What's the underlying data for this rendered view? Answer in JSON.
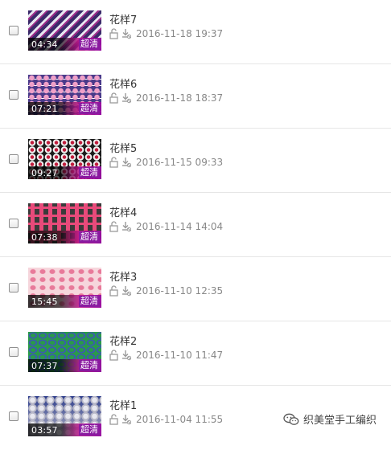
{
  "videos": [
    {
      "title": "花样7",
      "duration": "04:34",
      "quality": "超清",
      "date": "2016-11-18 19:37",
      "colors": [
        "#3a2a6a",
        "#e6e6f0",
        "#9c2c8a"
      ]
    },
    {
      "title": "花样6",
      "duration": "07:21",
      "quality": "超清",
      "date": "2016-11-18 18:37",
      "colors": [
        "#4a3a8a",
        "#f0a0c8",
        "#ffffff"
      ]
    },
    {
      "title": "花样5",
      "duration": "09:27",
      "quality": "超清",
      "date": "2016-11-15 09:33",
      "colors": [
        "#1a1a1a",
        "#f2f2f2",
        "#c01c3c"
      ]
    },
    {
      "title": "花样4",
      "duration": "07:38",
      "quality": "超清",
      "date": "2016-11-14 14:04",
      "colors": [
        "#3a3a3a",
        "#e84a7a",
        "#555555"
      ]
    },
    {
      "title": "花样3",
      "duration": "15:45",
      "quality": "超清",
      "date": "2016-11-10 12:35",
      "colors": [
        "#f6d6dc",
        "#e87a9a",
        "#fbe6ea"
      ]
    },
    {
      "title": "花样2",
      "duration": "07:37",
      "quality": "超清",
      "date": "2016-11-10 11:47",
      "colors": [
        "#2a9a4a",
        "#3a5ab0",
        "#1a7a3a"
      ]
    },
    {
      "title": "花样1",
      "duration": "03:57",
      "quality": "超清",
      "date": "2016-11-04 11:55",
      "colors": [
        "#b8b8c8",
        "#2a3a8a",
        "#e8e8f0"
      ]
    }
  ],
  "watermark": {
    "text": "织美堂手工编织"
  }
}
